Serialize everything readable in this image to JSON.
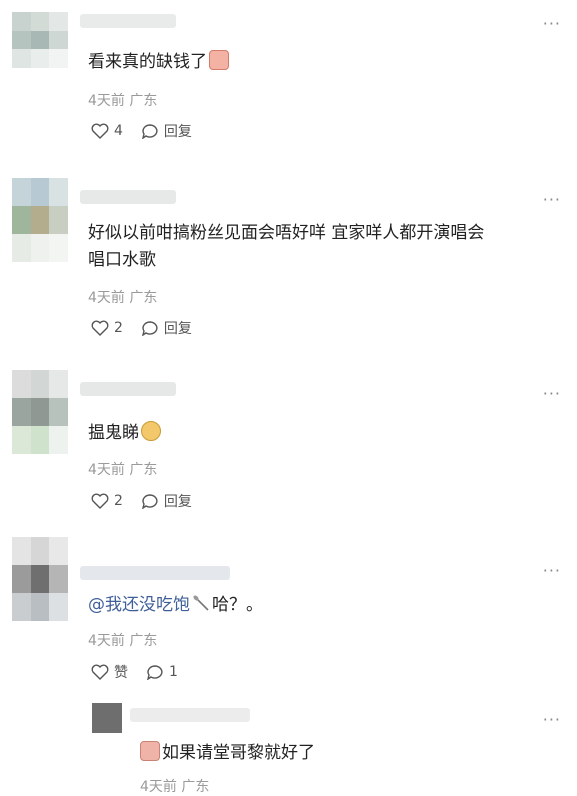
{
  "comments": [
    {
      "text": "看来真的缺钱了",
      "meta": "4天前 广东",
      "like_count": "4",
      "reply_label": "回复"
    },
    {
      "text_line1": "好似以前咁搞粉丝见面会唔好咩 宜家咩人都开演唱会",
      "text_line2": "唱口水歌",
      "meta": "4天前 广东",
      "like_count": "2",
      "reply_label": "回复"
    },
    {
      "text": "揾鬼睇",
      "meta": "4天前 广东",
      "like_count": "2",
      "reply_label": "回复"
    },
    {
      "mention": "@我还没吃饱",
      "text": "哈？。",
      "meta": "4天前 广东",
      "like_label": "赞",
      "reply_count": "1"
    }
  ],
  "reply": {
    "text": "如果请堂哥黎就好了",
    "meta_partial": "4天前 广东"
  },
  "more_glyph": "···",
  "colors": {
    "mention": "#3f5f99",
    "meta": "#9a9a9a"
  }
}
